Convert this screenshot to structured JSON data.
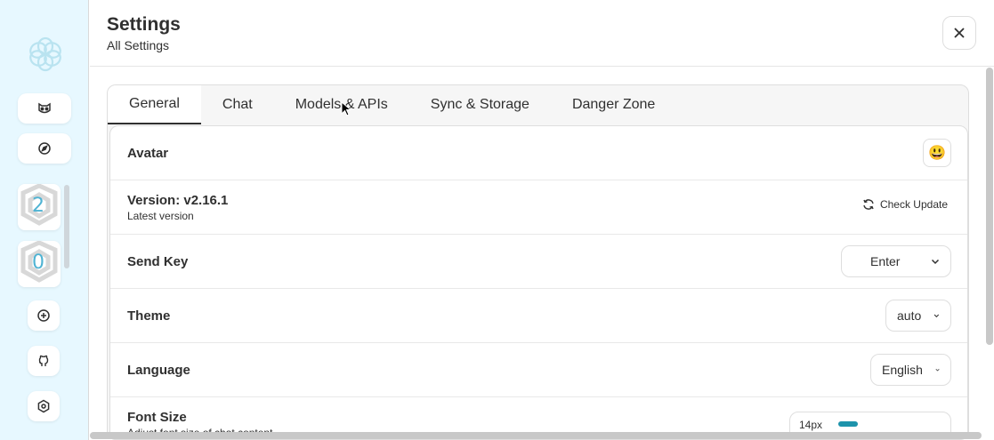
{
  "sidebar": {
    "mask_counts": [
      "2",
      "0"
    ]
  },
  "header": {
    "title": "Settings",
    "subtitle": "All Settings"
  },
  "tabs": [
    {
      "label": "General",
      "active": true
    },
    {
      "label": "Chat",
      "active": false
    },
    {
      "label": "Models & APIs",
      "active": false
    },
    {
      "label": "Sync & Storage",
      "active": false
    },
    {
      "label": "Danger Zone",
      "active": false
    }
  ],
  "settings": {
    "avatar": {
      "label": "Avatar",
      "emoji": "😃"
    },
    "version": {
      "label": "Version: v2.16.1",
      "sub": "Latest version",
      "button": "Check Update"
    },
    "send_key": {
      "label": "Send Key",
      "value": "Enter"
    },
    "theme": {
      "label": "Theme",
      "value": "auto"
    },
    "language": {
      "label": "Language",
      "value": "English"
    },
    "font_size": {
      "label": "Font Size",
      "sub": "Adjust font size of chat content",
      "value": "14px",
      "fill_fraction": 0.18
    }
  },
  "colors": {
    "sidebar_bg": "#e7f8ff",
    "accent": "#1d93ab"
  }
}
